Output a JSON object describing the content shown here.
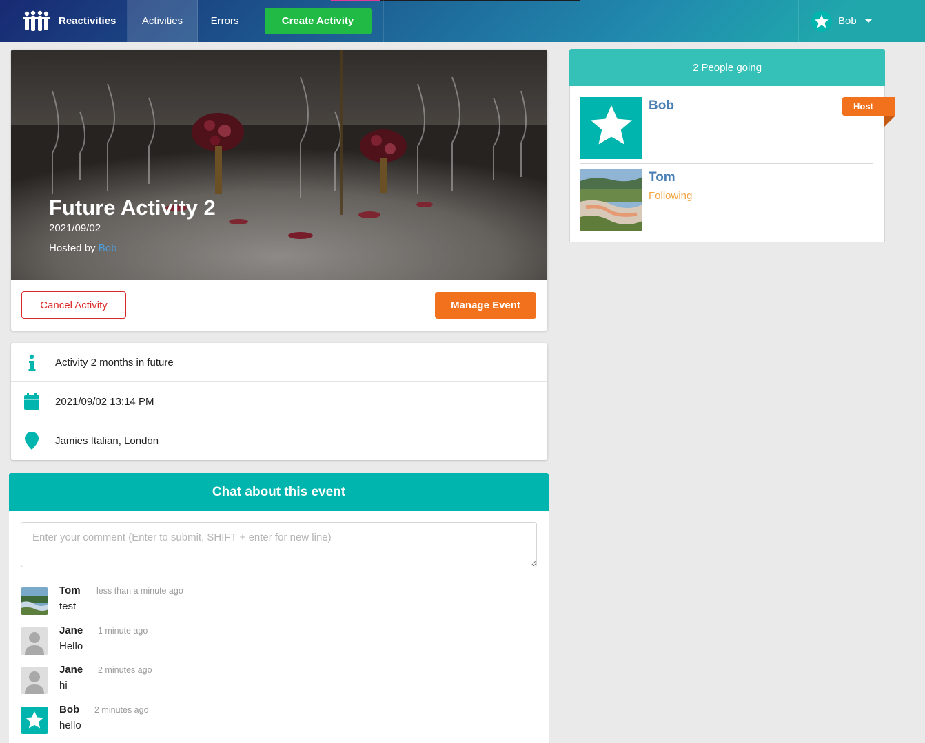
{
  "navbar": {
    "brand": "Reactivities",
    "links": {
      "activities": "Activities",
      "errors": "Errors"
    },
    "create_button": "Create Activity",
    "user": {
      "name": "Bob",
      "avatar_icon": "star-icon"
    },
    "colors": {
      "gradient_start": "#182a73",
      "gradient_mid": "#218aae",
      "gradient_end": "#20a7ac",
      "create": "#21ba45"
    }
  },
  "activity": {
    "title": "Future Activity 2",
    "date": "2021/09/02",
    "hosted_by_label": "Hosted by",
    "host": "Bob",
    "cancel_button": "Cancel Activity",
    "manage_button": "Manage Event"
  },
  "details": [
    {
      "icon": "info-icon",
      "text": "Activity 2 months in future"
    },
    {
      "icon": "calendar-icon",
      "text": "2021/09/02 13:14 PM"
    },
    {
      "icon": "map-marker-icon",
      "text": "Jamies Italian, London"
    }
  ],
  "chat": {
    "title": "Chat about this event",
    "placeholder": "Enter your comment (Enter to submit, SHIFT + enter for new line)",
    "comments": [
      {
        "author": "Tom",
        "time": "less than a minute ago",
        "text": "test",
        "avatar": "landscape-photo"
      },
      {
        "author": "Jane",
        "time": "1 minute ago",
        "text": "Hello",
        "avatar": "user-placeholder-icon"
      },
      {
        "author": "Jane",
        "time": "2 minutes ago",
        "text": "hi",
        "avatar": "user-placeholder-icon"
      },
      {
        "author": "Bob",
        "time": "2 minutes ago",
        "text": "hello",
        "avatar": "star-icon"
      }
    ]
  },
  "attendees": {
    "header": "2 People going",
    "list": [
      {
        "name": "Bob",
        "badge": "Host",
        "following": "",
        "avatar": "star-icon"
      },
      {
        "name": "Tom",
        "badge": "",
        "following": "Following",
        "avatar": "landscape-photo"
      }
    ]
  },
  "colors": {
    "teal": "#00b5ad",
    "orange": "#f2711c",
    "red": "#db2828",
    "link_blue": "#4a7fb5"
  }
}
